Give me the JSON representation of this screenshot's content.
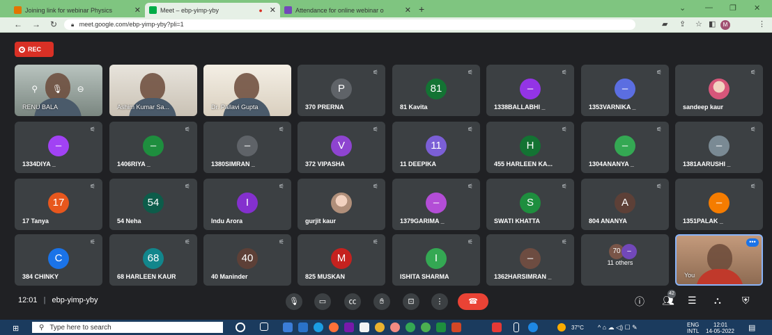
{
  "browser": {
    "tabs": [
      {
        "title": "Joining link for webinar Physics",
        "active": false,
        "icon_color": "#e37400"
      },
      {
        "title": "Meet – ebp-yimp-yby",
        "active": true,
        "icon_color": "#00ac47"
      },
      {
        "title": "Attendance for online webinar o",
        "active": false,
        "icon_color": "#7248b9"
      }
    ],
    "new_tab": "+",
    "url": "meet.google.com/ebp-yimp-yby?pli=1",
    "profile_initial": "M"
  },
  "meet": {
    "recording_label": "REC",
    "meeting_time": "12:01",
    "meeting_code": "ebp-yimp-yby",
    "participant_count": "42",
    "accent": "#8ab4f8",
    "end_call_color": "#ea4335",
    "tiles": [
      {
        "name": "RENU BALA",
        "kind": "video"
      },
      {
        "name": "Ashim Kumar Sa...",
        "kind": "video"
      },
      {
        "name": "Dr. Pallavi Gupta",
        "kind": "video"
      },
      {
        "name": "370 PRERNA",
        "kind": "avatar",
        "avatar_text": "P",
        "avatar_color": "#5f6368"
      },
      {
        "name": "81 Kavita",
        "kind": "avatar",
        "avatar_text": "81",
        "avatar_color": "#137333"
      },
      {
        "name": "1338BALLABHI _",
        "kind": "avatar",
        "avatar_text": "–",
        "avatar_color": "#9334e6"
      },
      {
        "name": "1353VARNIKA _",
        "kind": "avatar",
        "avatar_text": "–",
        "avatar_color": "#5b6ee1"
      },
      {
        "name": "sandeep kaur",
        "kind": "photo",
        "avatar_color": "#d7567a"
      },
      {
        "name": "1334DIYA _",
        "kind": "avatar",
        "avatar_text": "–",
        "avatar_color": "#a142f4"
      },
      {
        "name": "1406RIYA _",
        "kind": "avatar",
        "avatar_text": "–",
        "avatar_color": "#1e8e3e"
      },
      {
        "name": "1380SIMRAN _",
        "kind": "avatar",
        "avatar_text": "–",
        "avatar_color": "#5f6368"
      },
      {
        "name": "372 VIPASHA",
        "kind": "avatar",
        "avatar_text": "V",
        "avatar_color": "#8e44d0"
      },
      {
        "name": "11 DEEPIKA",
        "kind": "avatar",
        "avatar_text": "11",
        "avatar_color": "#7b5fd6"
      },
      {
        "name": "455 HARLEEN KA...",
        "kind": "avatar",
        "avatar_text": "H",
        "avatar_color": "#137333"
      },
      {
        "name": "1304ANANYA _",
        "kind": "avatar",
        "avatar_text": "–",
        "avatar_color": "#34a853"
      },
      {
        "name": "1381AARUSHI _",
        "kind": "avatar",
        "avatar_text": "–",
        "avatar_color": "#7a8a94"
      },
      {
        "name": "17 Tanya",
        "kind": "avatar",
        "avatar_text": "17",
        "avatar_color": "#e8571d"
      },
      {
        "name": "54 Neha",
        "kind": "avatar",
        "avatar_text": "54",
        "avatar_color": "#0d5c4a"
      },
      {
        "name": "Indu Arora",
        "kind": "avatar",
        "avatar_text": "I",
        "avatar_color": "#8430ce"
      },
      {
        "name": "gurjit kaur",
        "kind": "photo",
        "avatar_color": "#b08f7a"
      },
      {
        "name": "1379GARIMA _",
        "kind": "avatar",
        "avatar_text": "–",
        "avatar_color": "#b34dd6"
      },
      {
        "name": "SWATI KHATTA",
        "kind": "avatar",
        "avatar_text": "S",
        "avatar_color": "#1e8e3e"
      },
      {
        "name": "804 ANANYA",
        "kind": "avatar",
        "avatar_text": "A",
        "avatar_color": "#5d4037"
      },
      {
        "name": "1351PALAK _",
        "kind": "avatar",
        "avatar_text": "–",
        "avatar_color": "#f57c00"
      },
      {
        "name": "384 CHINKY",
        "kind": "avatar",
        "avatar_text": "C",
        "avatar_color": "#1a73e8"
      },
      {
        "name": "68 HARLEEN KAUR",
        "kind": "avatar",
        "avatar_text": "68",
        "avatar_color": "#12868c"
      },
      {
        "name": "40 Maninder",
        "kind": "avatar",
        "avatar_text": "40",
        "avatar_color": "#5d4037"
      },
      {
        "name": "825 MUSKAN",
        "kind": "avatar",
        "avatar_text": "M",
        "avatar_color": "#c5221f"
      },
      {
        "name": "ISHITA SHARMA",
        "kind": "avatar",
        "avatar_text": "I",
        "avatar_color": "#34a853"
      },
      {
        "name": "1362HARSIMRAN _",
        "kind": "avatar",
        "avatar_text": "–",
        "avatar_color": "#6d4c41"
      },
      {
        "name": "11 others",
        "kind": "others",
        "avatar_text": "70",
        "avatar_color": "#795548"
      },
      {
        "name": "You",
        "kind": "self"
      }
    ]
  },
  "taskbar": {
    "search_placeholder": "Type here to search",
    "weather": "37°C",
    "language": "ENG",
    "language_sub": "INTL",
    "time": "12:01",
    "date": "14-05-2022"
  }
}
